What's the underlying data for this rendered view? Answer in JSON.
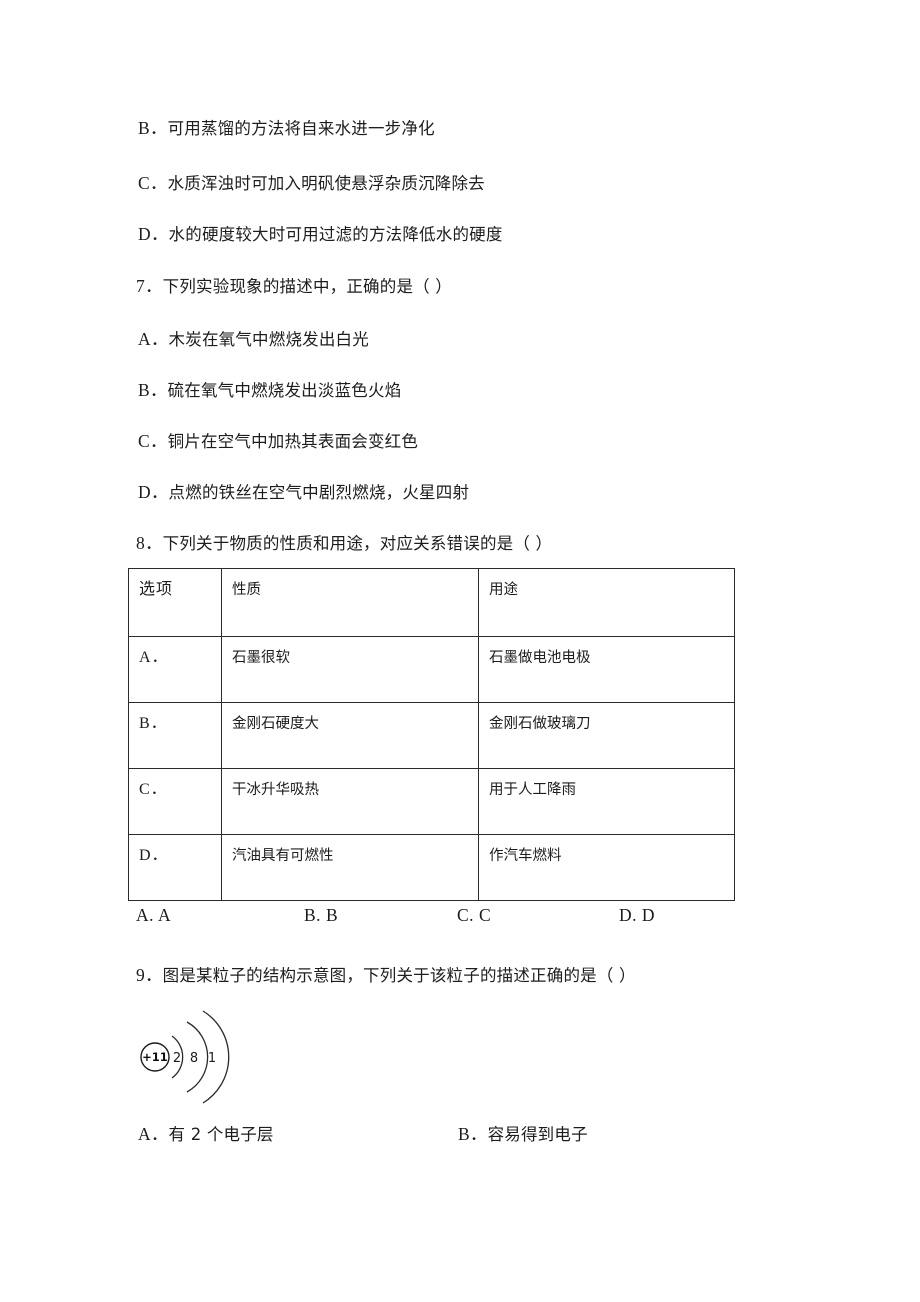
{
  "document": {
    "type": "exam-paper",
    "language": "zh-CN",
    "subject": "chemistry"
  },
  "q6_remaining_options": [
    {
      "label": "B．",
      "text": "可用蒸馏的方法将自来水进一步净化"
    },
    {
      "label": "C．",
      "text": "水质浑浊时可加入明矾使悬浮杂质沉降除去"
    },
    {
      "label": "D．",
      "text": "水的硬度较大时可用过滤的方法降低水的硬度"
    }
  ],
  "q7": {
    "number": "7．",
    "stem": "下列实验现象的描述中，正确的是（        ）",
    "options": [
      {
        "label": "A．",
        "text": "木炭在氧气中燃烧发出白光"
      },
      {
        "label": "B．",
        "text": "硫在氧气中燃烧发出淡蓝色火焰"
      },
      {
        "label": "C．",
        "text": "铜片在空气中加热其表面会变红色"
      },
      {
        "label": "D．",
        "text": "点燃的铁丝在空气中剧烈燃烧，火星四射"
      }
    ]
  },
  "q8": {
    "number": "8．",
    "stem": "下列关于物质的性质和用途，对应关系错误的是（      ）",
    "table": {
      "headers": [
        "选项",
        "性质",
        "用途"
      ],
      "rows": [
        {
          "option": "A．",
          "property": "石墨很软",
          "use": "石墨做电池电极"
        },
        {
          "option": "B．",
          "property": "金刚石硬度大",
          "use": "金刚石做玻璃刀"
        },
        {
          "option": "C．",
          "property": "干冰升华吸热",
          "use": "用于人工降雨"
        },
        {
          "option": "D．",
          "property": "汽油具有可燃性",
          "use": "作汽车燃料"
        }
      ]
    },
    "choices": [
      {
        "label": "A.",
        "value": "A"
      },
      {
        "label": "B.",
        "value": "B"
      },
      {
        "label": "C.",
        "value": "C"
      },
      {
        "label": "D.",
        "value": "D"
      }
    ]
  },
  "q9": {
    "number": "9．",
    "stem": "图是某粒子的结构示意图，下列关于该粒子的描述正确的是（        ）",
    "diagram": {
      "nucleus_charge": "+11",
      "shell_electrons": [
        "2",
        "8",
        "1"
      ],
      "shell_count": 3
    },
    "options": [
      {
        "label": "A．",
        "text": "有 2 个电子层"
      },
      {
        "label": "B．",
        "text": "容易得到电子"
      }
    ]
  }
}
